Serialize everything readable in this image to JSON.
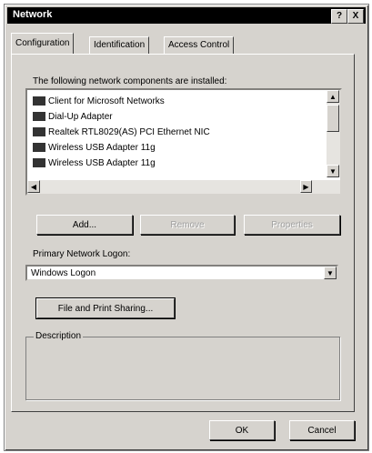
{
  "window": {
    "title": "Network"
  },
  "titlebar_buttons": {
    "help": "?",
    "close": "X"
  },
  "tabs": [
    {
      "label": "Configuration",
      "active": true
    },
    {
      "label": "Identification",
      "active": false
    },
    {
      "label": "Access Control",
      "active": false
    }
  ],
  "components": {
    "heading": "The following network components are installed:",
    "items": [
      {
        "label": "Client for Microsoft Networks",
        "icon": "client-icon"
      },
      {
        "label": "Dial-Up Adapter",
        "icon": "adapter-icon"
      },
      {
        "label": "Realtek RTL8029(AS) PCI Ethernet NIC",
        "icon": "adapter-icon"
      },
      {
        "label": "Wireless USB Adapter 11g",
        "icon": "adapter-icon"
      },
      {
        "label": "Wireless USB Adapter 11g",
        "icon": "adapter-icon"
      }
    ]
  },
  "buttons": {
    "add": "Add...",
    "remove": "Remove",
    "properties": "Properties"
  },
  "logon": {
    "label": "Primary Network Logon:",
    "value": "Windows Logon"
  },
  "file_print_button": "File and Print Sharing...",
  "description": {
    "legend": "Description"
  },
  "footer": {
    "ok": "OK",
    "cancel": "Cancel"
  }
}
